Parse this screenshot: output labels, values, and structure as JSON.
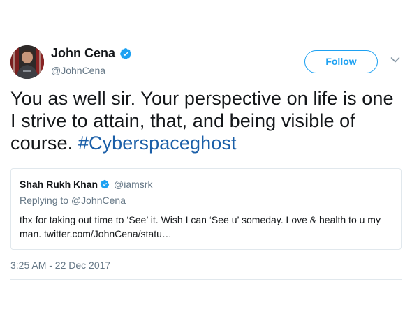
{
  "author": {
    "name": "John Cena",
    "handle": "@JohnCena",
    "verified": true
  },
  "follow_button": {
    "label": "Follow"
  },
  "tweet": {
    "text_plain": "You as well sir. Your perspective on life is one I strive to attain, that, and being visible of course.",
    "hashtag": "#Cyberspaceghost",
    "timestamp": "3:25 AM - 22 Dec 2017"
  },
  "quoted_tweet": {
    "name": "Shah Rukh Khan",
    "handle": "@iamsrk",
    "verified": true,
    "replying_prefix": "Replying to",
    "replying_to": "@JohnCena",
    "text": "thx for taking out time to ‘See’ it. Wish I can ‘See u’ someday. Love & health to u my man. twitter.com/JohnCena/statu…"
  },
  "icons": {
    "verified": "verified-badge-icon",
    "more": "chevron-down-icon"
  },
  "colors": {
    "accent": "#1da1f2",
    "hashtag": "#1b5fa8",
    "muted": "#657786",
    "border": "#e1e8ed",
    "text": "#14171a"
  }
}
